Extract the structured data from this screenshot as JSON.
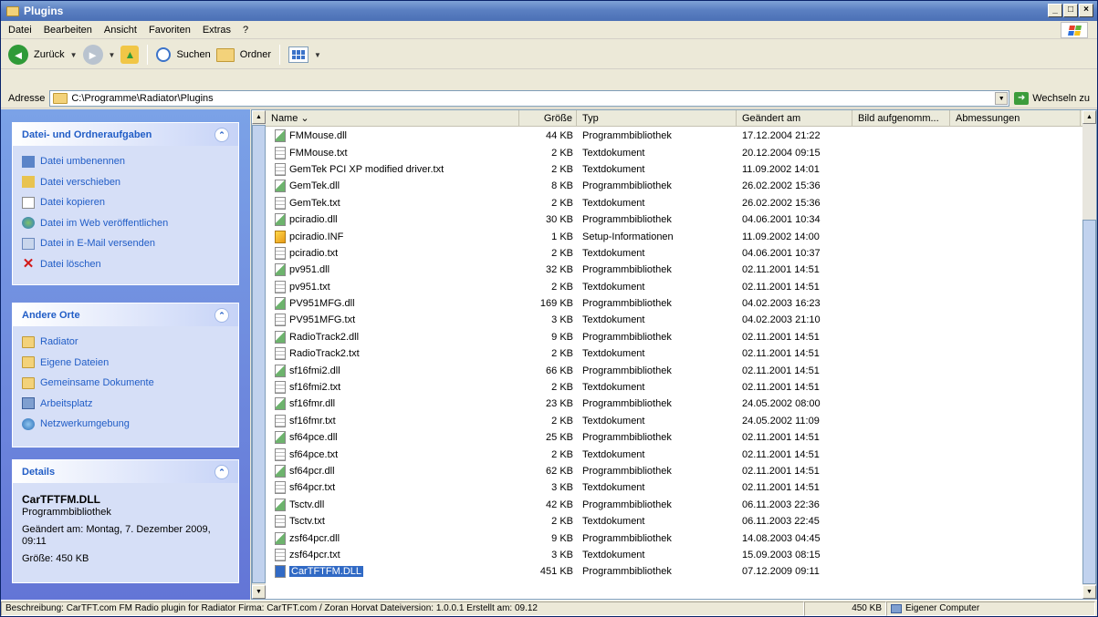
{
  "window": {
    "title": "Plugins",
    "btn_min": "_",
    "btn_max": "□",
    "btn_close": "×"
  },
  "menu": [
    "Datei",
    "Bearbeiten",
    "Ansicht",
    "Favoriten",
    "Extras",
    "?"
  ],
  "toolbar": {
    "back": "Zurück",
    "search": "Suchen",
    "folders": "Ordner"
  },
  "address": {
    "label": "Adresse",
    "path": "C:\\Programme\\Radiator\\Plugins",
    "go": "Wechseln zu"
  },
  "tasks": {
    "title": "Datei- und Ordneraufgaben",
    "items": [
      "Datei umbenennen",
      "Datei verschieben",
      "Datei kopieren",
      "Datei im Web veröffentlichen",
      "Datei in E-Mail versenden",
      "Datei löschen"
    ]
  },
  "places": {
    "title": "Andere Orte",
    "items": [
      "Radiator",
      "Eigene Dateien",
      "Gemeinsame Dokumente",
      "Arbeitsplatz",
      "Netzwerkumgebung"
    ]
  },
  "details": {
    "title": "Details",
    "name": "CarTFTFM.DLL",
    "type": "Programmbibliothek",
    "changed": "Geändert am: Montag, 7. Dezember 2009, 09:11",
    "size": "Größe: 450 KB"
  },
  "columns": [
    "Name",
    "Größe",
    "Typ",
    "Geändert am",
    "Bild aufgenomm...",
    "Abmessungen"
  ],
  "files": [
    {
      "name": "FMMouse.dll",
      "size": "44 KB",
      "type": "Programmbibliothek",
      "date": "17.12.2004 21:22",
      "kind": "dll"
    },
    {
      "name": "FMMouse.txt",
      "size": "2 KB",
      "type": "Textdokument",
      "date": "20.12.2004 09:15",
      "kind": "txt"
    },
    {
      "name": "GemTek PCI XP modified driver.txt",
      "size": "2 KB",
      "type": "Textdokument",
      "date": "11.09.2002 14:01",
      "kind": "txt"
    },
    {
      "name": "GemTek.dll",
      "size": "8 KB",
      "type": "Programmbibliothek",
      "date": "26.02.2002 15:36",
      "kind": "dll"
    },
    {
      "name": "GemTek.txt",
      "size": "2 KB",
      "type": "Textdokument",
      "date": "26.02.2002 15:36",
      "kind": "txt"
    },
    {
      "name": "pciradio.dll",
      "size": "30 KB",
      "type": "Programmbibliothek",
      "date": "04.06.2001 10:34",
      "kind": "dll"
    },
    {
      "name": "pciradio.INF",
      "size": "1 KB",
      "type": "Setup-Informationen",
      "date": "11.09.2002 14:00",
      "kind": "inf"
    },
    {
      "name": "pciradio.txt",
      "size": "2 KB",
      "type": "Textdokument",
      "date": "04.06.2001 10:37",
      "kind": "txt"
    },
    {
      "name": "pv951.dll",
      "size": "32 KB",
      "type": "Programmbibliothek",
      "date": "02.11.2001 14:51",
      "kind": "dll"
    },
    {
      "name": "pv951.txt",
      "size": "2 KB",
      "type": "Textdokument",
      "date": "02.11.2001 14:51",
      "kind": "txt"
    },
    {
      "name": "PV951MFG.dll",
      "size": "169 KB",
      "type": "Programmbibliothek",
      "date": "04.02.2003 16:23",
      "kind": "dll"
    },
    {
      "name": "PV951MFG.txt",
      "size": "3 KB",
      "type": "Textdokument",
      "date": "04.02.2003 21:10",
      "kind": "txt"
    },
    {
      "name": "RadioTrack2.dll",
      "size": "9 KB",
      "type": "Programmbibliothek",
      "date": "02.11.2001 14:51",
      "kind": "dll"
    },
    {
      "name": "RadioTrack2.txt",
      "size": "2 KB",
      "type": "Textdokument",
      "date": "02.11.2001 14:51",
      "kind": "txt"
    },
    {
      "name": "sf16fmi2.dll",
      "size": "66 KB",
      "type": "Programmbibliothek",
      "date": "02.11.2001 14:51",
      "kind": "dll"
    },
    {
      "name": "sf16fmi2.txt",
      "size": "2 KB",
      "type": "Textdokument",
      "date": "02.11.2001 14:51",
      "kind": "txt"
    },
    {
      "name": "sf16fmr.dll",
      "size": "23 KB",
      "type": "Programmbibliothek",
      "date": "24.05.2002 08:00",
      "kind": "dll"
    },
    {
      "name": "sf16fmr.txt",
      "size": "2 KB",
      "type": "Textdokument",
      "date": "24.05.2002 11:09",
      "kind": "txt"
    },
    {
      "name": "sf64pce.dll",
      "size": "25 KB",
      "type": "Programmbibliothek",
      "date": "02.11.2001 14:51",
      "kind": "dll"
    },
    {
      "name": "sf64pce.txt",
      "size": "2 KB",
      "type": "Textdokument",
      "date": "02.11.2001 14:51",
      "kind": "txt"
    },
    {
      "name": "sf64pcr.dll",
      "size": "62 KB",
      "type": "Programmbibliothek",
      "date": "02.11.2001 14:51",
      "kind": "dll"
    },
    {
      "name": "sf64pcr.txt",
      "size": "3 KB",
      "type": "Textdokument",
      "date": "02.11.2001 14:51",
      "kind": "txt"
    },
    {
      "name": "Tsctv.dll",
      "size": "42 KB",
      "type": "Programmbibliothek",
      "date": "06.11.2003 22:36",
      "kind": "dll"
    },
    {
      "name": "Tsctv.txt",
      "size": "2 KB",
      "type": "Textdokument",
      "date": "06.11.2003 22:45",
      "kind": "txt"
    },
    {
      "name": "zsf64pcr.dll",
      "size": "9 KB",
      "type": "Programmbibliothek",
      "date": "14.08.2003 04:45",
      "kind": "dll"
    },
    {
      "name": "zsf64pcr.txt",
      "size": "3 KB",
      "type": "Textdokument",
      "date": "15.09.2003 08:15",
      "kind": "txt"
    },
    {
      "name": "CarTFTFM.DLL",
      "size": "451 KB",
      "type": "Programmbibliothek",
      "date": "07.12.2009 09:11",
      "kind": "dll",
      "selected": true
    }
  ],
  "status": {
    "description": "Beschreibung: CarTFT.com FM Radio plugin for Radiator Firma: CarTFT.com / Zoran Horvat Dateiversion: 1.0.0.1 Erstellt am: 09.12",
    "size": "450 KB",
    "location": "Eigener Computer"
  }
}
